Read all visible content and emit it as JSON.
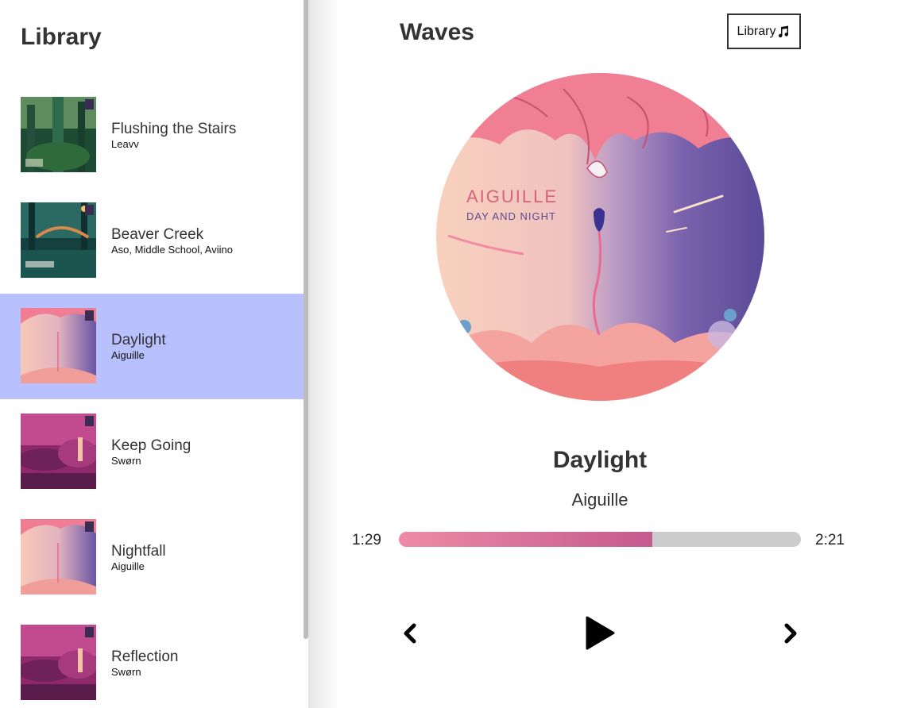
{
  "app": {
    "title": "Waves"
  },
  "library": {
    "title": "Library",
    "songs": [
      {
        "title": "Flushing the Stairs",
        "artist": "Leavv",
        "cover": "forest",
        "selected": false
      },
      {
        "title": "Beaver Creek",
        "artist": "Aso, Middle School, Aviino",
        "cover": "creek",
        "selected": false
      },
      {
        "title": "Daylight",
        "artist": "Aiguille",
        "cover": "daynight",
        "selected": true
      },
      {
        "title": "Keep Going",
        "artist": "Swørn",
        "cover": "magenta",
        "selected": false
      },
      {
        "title": "Nightfall",
        "artist": "Aiguille",
        "cover": "daynight",
        "selected": false
      },
      {
        "title": "Reflection",
        "artist": "Swørn",
        "cover": "magenta",
        "selected": false
      }
    ]
  },
  "header": {
    "library_button_label": "Library",
    "library_button_icon": "music-note-icon"
  },
  "now_playing": {
    "title": "Daylight",
    "artist": "Aiguille",
    "album_art": {
      "band": "AIGUILLE",
      "album": "DAY AND NIGHT"
    }
  },
  "progress": {
    "current": "1:29",
    "total": "2:21",
    "fraction": 0.63
  },
  "controls": {
    "prev_icon": "chevron-left-icon",
    "play_icon": "play-icon",
    "next_icon": "chevron-right-icon"
  },
  "colors": {
    "selected_row": "#b8c1fe",
    "progress_start": "#ee8aa6",
    "progress_end": "#c45a8e",
    "track": "#cccccc"
  }
}
